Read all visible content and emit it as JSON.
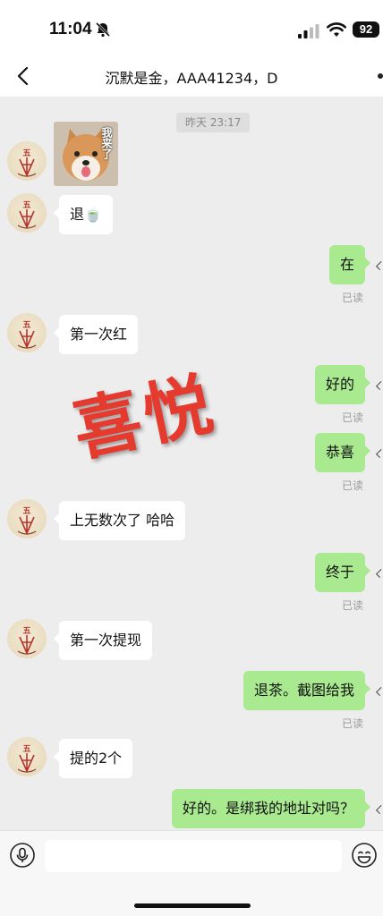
{
  "status_bar": {
    "time": "11:04",
    "battery": "92"
  },
  "header": {
    "title": "沉默是金，AAA41234，D"
  },
  "chat": {
    "timestamp": "昨天 23:17",
    "sticker_text": "我来了",
    "messages": [
      {
        "dir": "in",
        "text": "退🍵"
      },
      {
        "dir": "out",
        "text": "在",
        "status": "已读"
      },
      {
        "dir": "in",
        "text": "第一次红"
      },
      {
        "dir": "out",
        "text": "好的",
        "status": "已读"
      },
      {
        "dir": "out",
        "text": "恭喜",
        "status": "已读"
      },
      {
        "dir": "in",
        "text": "上无数次了 哈哈"
      },
      {
        "dir": "out",
        "text": "终于",
        "status": "已读"
      },
      {
        "dir": "in",
        "text": "第一次提现"
      },
      {
        "dir": "out",
        "text": "退茶。截图给我",
        "status": "已读"
      },
      {
        "dir": "in",
        "text": "提的2个"
      },
      {
        "dir": "out",
        "text": "好的。是绑我的地址对吗？"
      }
    ]
  },
  "watermark": "喜悦",
  "input": {
    "value": ""
  },
  "colors": {
    "out_bubble": "#a9e98f",
    "in_bubble": "#ffffff",
    "background": "#ededed",
    "watermark": "#e53a2e"
  },
  "icons": [
    "bell-off-icon",
    "signal-icon",
    "wifi-icon",
    "back-icon",
    "more-icon",
    "voice-icon",
    "emoji-icon"
  ]
}
